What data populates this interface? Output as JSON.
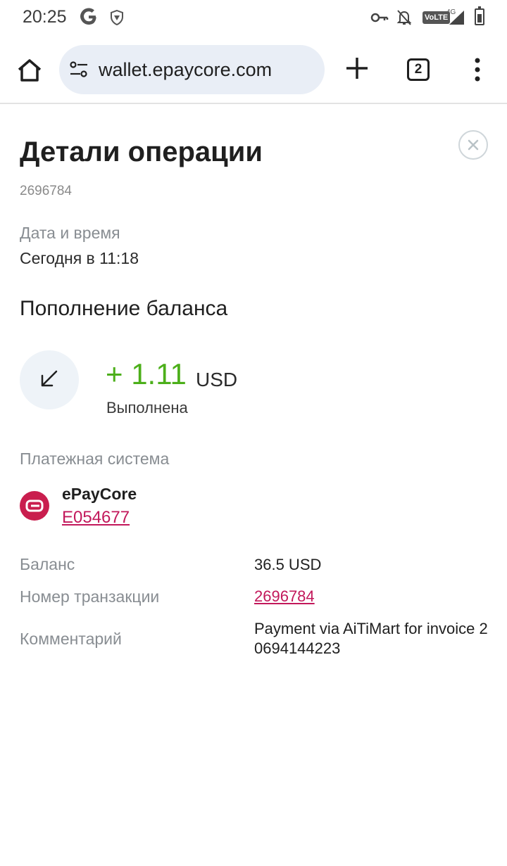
{
  "status_bar": {
    "time": "20:25",
    "network_badge": "VoLTE",
    "network_type": "4G",
    "icons": [
      "google-icon",
      "shield-icon",
      "key-icon",
      "bell-off-icon",
      "signal-icon",
      "battery-icon"
    ]
  },
  "browser": {
    "url": "wallet.epaycore.com",
    "tab_count": "2"
  },
  "page": {
    "title": "Детали операции",
    "operation_id": "2696784",
    "datetime_label": "Дата и время",
    "datetime_value": "Сегодня в 11:18",
    "operation_type": "Пополнение баланса",
    "amount": "+ 1.11",
    "currency": "USD",
    "status": "Выполнена",
    "payment_system_label": "Платежная система",
    "payment_system_name": "ePayCore",
    "payment_system_account": "E054677",
    "details": {
      "balance_label": "Баланс",
      "balance_value": "36.5 USD",
      "tx_number_label": "Номер транзакции",
      "tx_number_value": "2696784",
      "comment_label": "Комментарий",
      "comment_value": "Payment via AiTiMart for invoice 20694144223"
    }
  },
  "colors": {
    "amount_green": "#4caf1a",
    "link_pink": "#c2185b",
    "brand_red": "#c91e4e",
    "url_bar_bg": "#e9eef6"
  }
}
